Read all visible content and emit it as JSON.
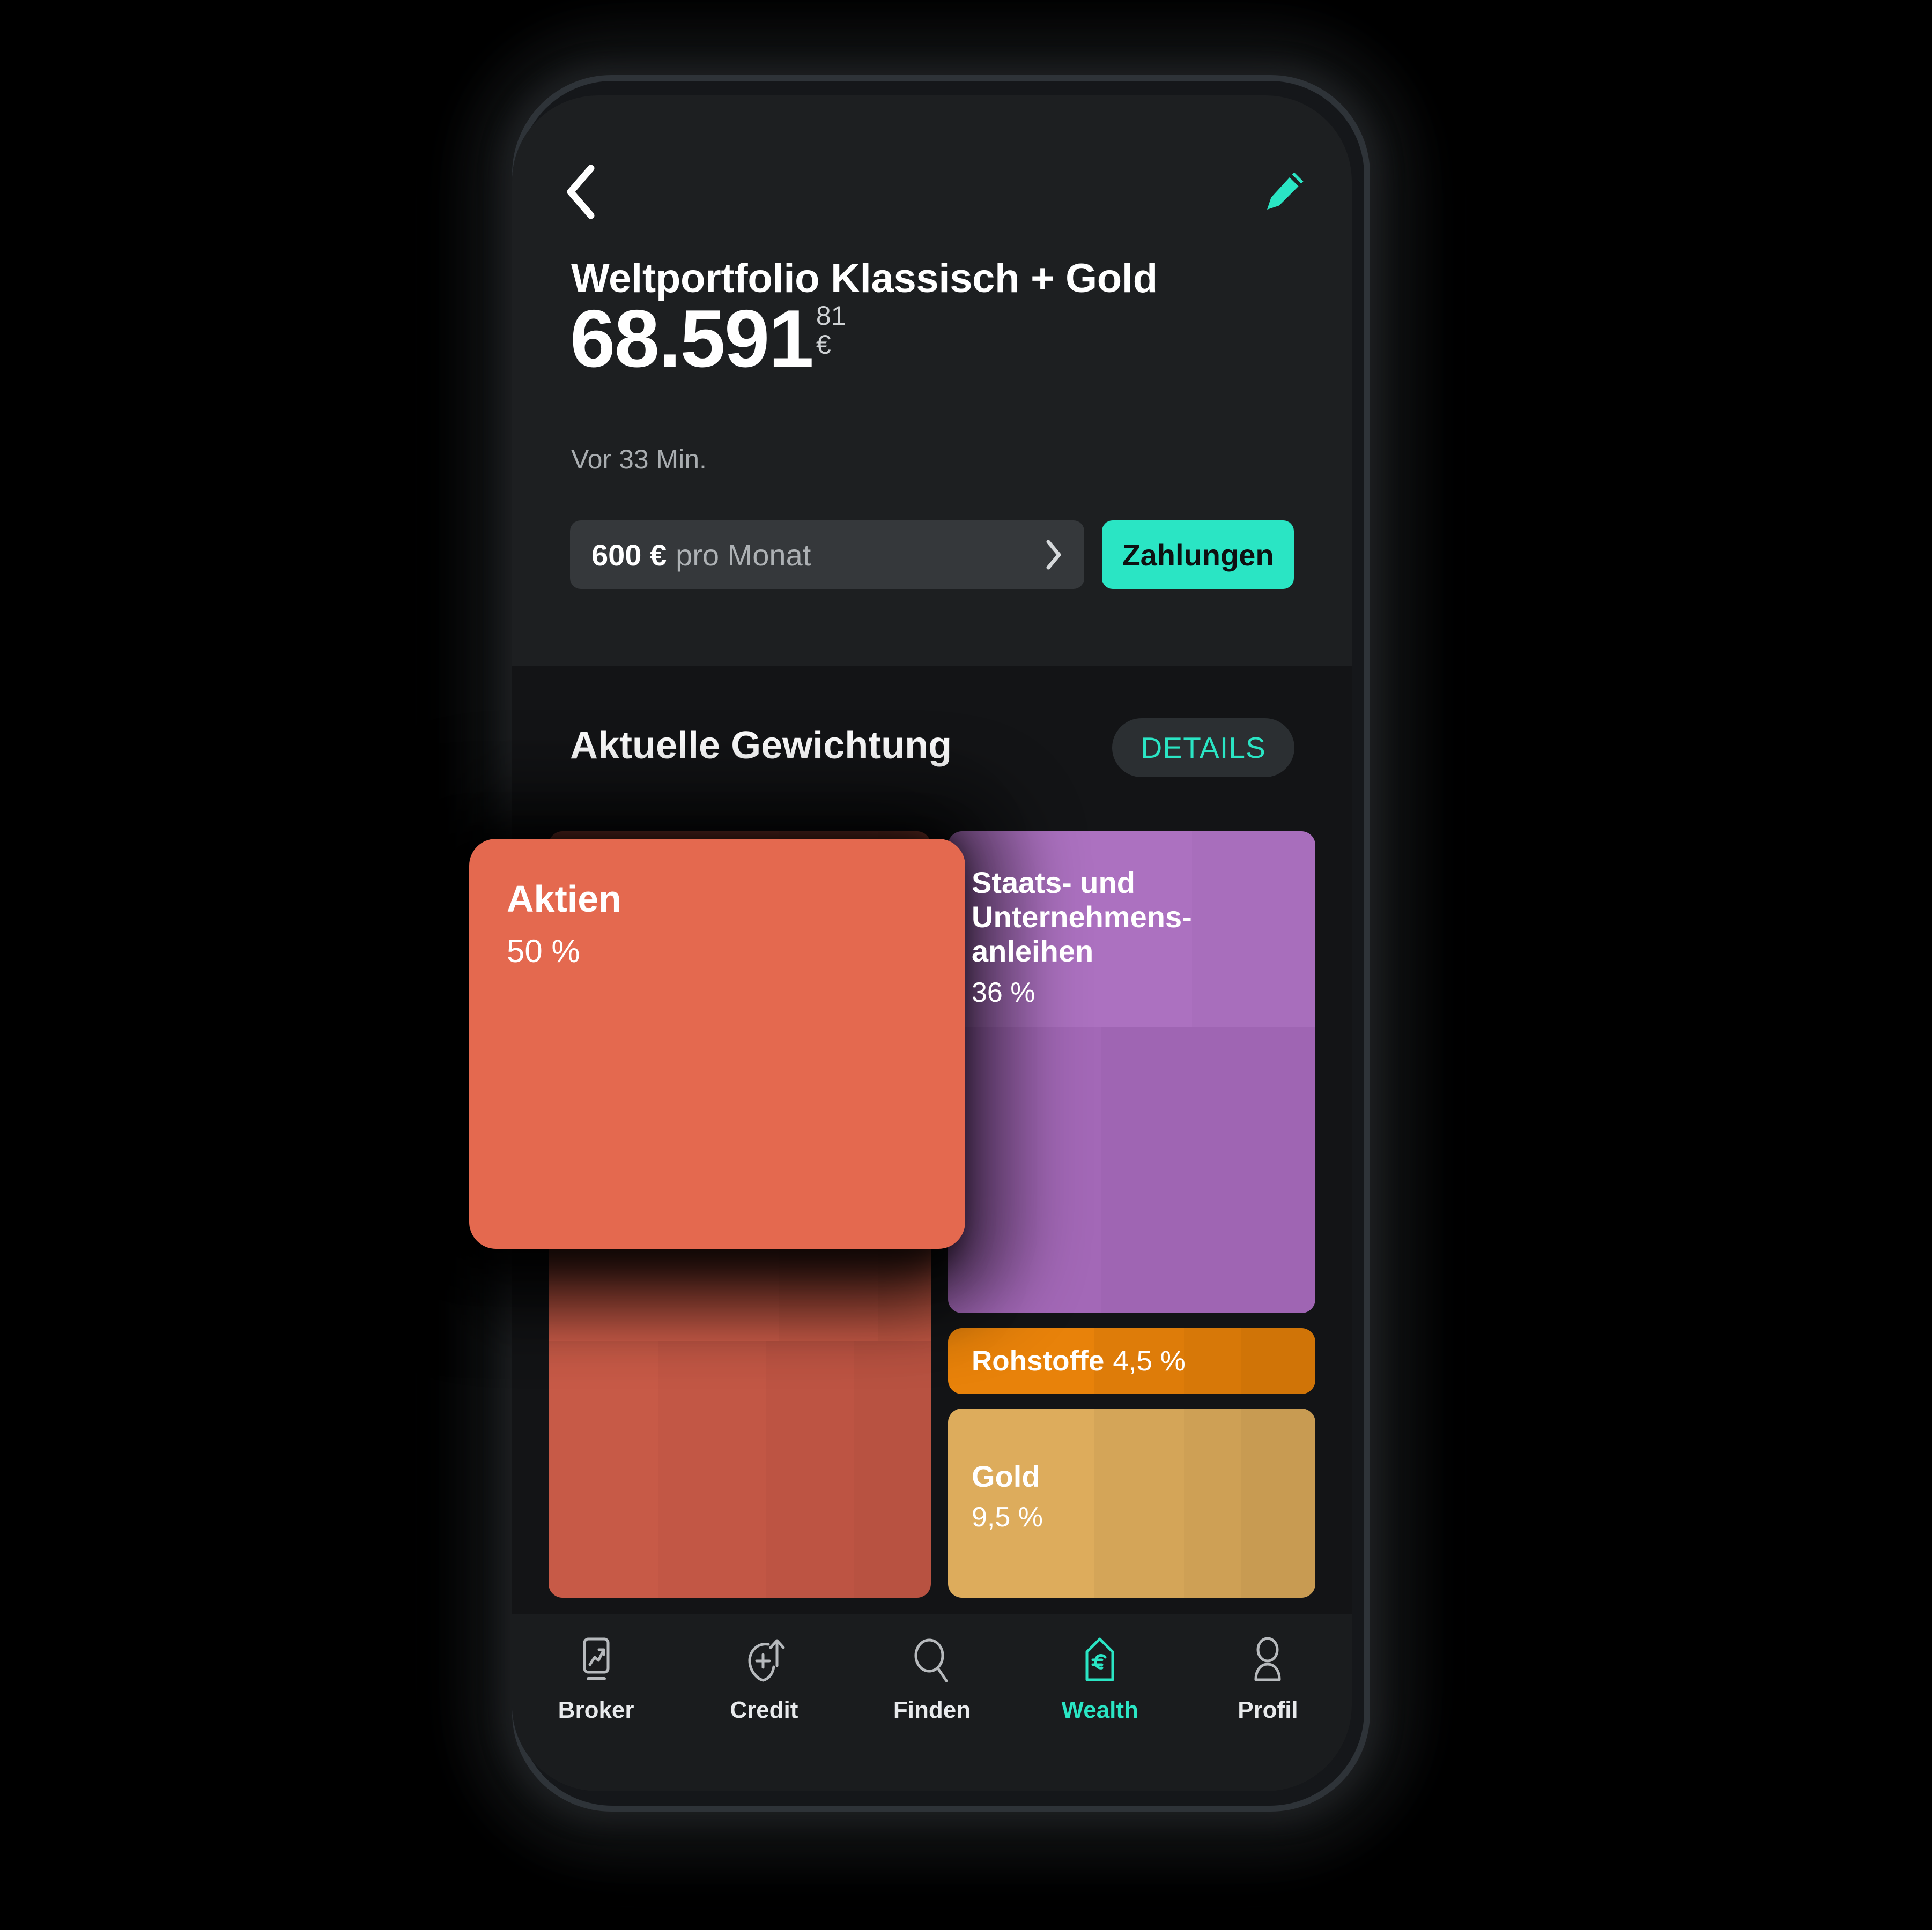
{
  "theme": {
    "accent": "#2ae5c4",
    "screen_bg": "#131416",
    "header_bg": "#1d1f21",
    "pill_bg": "#35383b",
    "tabbar_bg": "#1a1c1e"
  },
  "header": {
    "back_icon": "chevron-left-icon",
    "edit_icon": "pencil-icon",
    "portfolio_title": "Weltportfolio Klassisch + Gold",
    "balance_main": "68.591",
    "balance_cents": "81",
    "balance_currency": "€",
    "updated": "Vor 33 Min.",
    "plan": {
      "amount": "600 €",
      "period": "pro Monat",
      "chevron_icon": "chevron-right-icon"
    },
    "payments_label": "Zahlungen"
  },
  "weighting": {
    "section_title": "Aktuelle Gewichtung",
    "details_label": "DETAILS"
  },
  "chart_data": {
    "type": "treemap",
    "title": "Aktuelle Gewichtung",
    "unit": "%",
    "categories": [
      "Aktien",
      "Staats- und Unternehmens-anleihen",
      "Rohstoffe",
      "Gold"
    ],
    "values": [
      50,
      36,
      4.5,
      9.5
    ],
    "labels": [
      "50 %",
      "36 %",
      "4,5 %",
      "9,5 %"
    ],
    "colors": [
      "#e4694f",
      "#a96cbe",
      "#e8820a",
      "#ddac5c"
    ],
    "slices": [
      {
        "name": "Aktien",
        "pct_label": "50 %",
        "value": 50,
        "color": "#e4694f",
        "floating": true
      },
      {
        "name_line1": "Staats- und",
        "name_line2": "Unternehmens-",
        "name_line3": "anleihen",
        "name": "Staats- und Unternehmens-anleihen",
        "pct_label": "36 %",
        "value": 36,
        "color": "#a96cbe"
      },
      {
        "name": "Rohstoffe",
        "pct_label": "4,5 %",
        "value": 4.5,
        "color": "#e8820a"
      },
      {
        "name": "Gold",
        "pct_label": "9,5 %",
        "value": 9.5,
        "color": "#ddac5c"
      }
    ]
  },
  "tabbar": {
    "items": [
      {
        "label": "Broker",
        "icon": "phone-chart-icon",
        "active": false
      },
      {
        "label": "Credit",
        "icon": "credit-plus-arrow-icon",
        "active": false
      },
      {
        "label": "Finden",
        "icon": "search-icon",
        "active": false
      },
      {
        "label": "Wealth",
        "icon": "euro-shield-icon",
        "active": true
      },
      {
        "label": "Profil",
        "icon": "person-icon",
        "active": false
      }
    ]
  }
}
